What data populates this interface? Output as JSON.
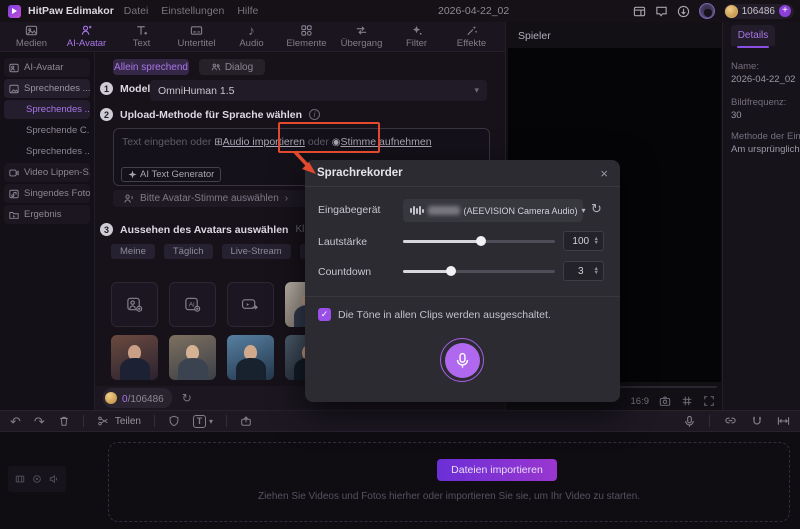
{
  "menubar": {
    "app_title": "HitPaw Edimakor",
    "menu_items": [
      "Datei",
      "Einstellungen",
      "Hilfe"
    ],
    "project_name": "2026-04-22_02",
    "credits": "106486"
  },
  "ribbon": {
    "tabs": [
      "Medien",
      "AI-Avatar",
      "Text",
      "Untertitel",
      "Audio",
      "Elemente",
      "Übergang",
      "Filter",
      "Effekte"
    ],
    "active_tab": "AI-Avatar"
  },
  "sidebar": {
    "items": [
      "AI-Avatar",
      "Sprechendes ...",
      "Sprechendes ...",
      "Sprechende C...",
      "Sprechendes ...",
      "Video Lippen-S...",
      "Singendes Foto",
      "Ergebnis"
    ]
  },
  "main": {
    "tab_solo": "Allein sprechend",
    "tab_dialog": "Dialog",
    "step1_num": "1",
    "step1_label": "Modell",
    "model_value": "OmniHuman 1.5",
    "step2_num": "2",
    "step2_label": "Upload-Methode für Sprache wählen",
    "text_prefix": "Text eingeben oder",
    "audio_link": "Audio importieren",
    "or_word": "oder",
    "record_link": "Stimme aufnehmen",
    "ai_generator": "AI Text Generator",
    "voice_select": "Bitte Avatar-Stimme auswählen",
    "step3_num": "3",
    "step3_label": "Aussehen des Avatars auswählen",
    "step3_hint": "Klicken Sie au",
    "categories": [
      "Meine",
      "Täglich",
      "Live-Stream",
      "Festival"
    ],
    "credits_used": "0",
    "credits_total": "/106486"
  },
  "player": {
    "title": "Spieler",
    "ratio": "16:9"
  },
  "details": {
    "tab": "Details",
    "fields": [
      {
        "label": "Name:",
        "value": "2026-04-22_02"
      },
      {
        "label": "Bildfrequenz:",
        "value": "30"
      },
      {
        "label": "Methode der Einfü",
        "value": "Am ursprünglichen"
      }
    ]
  },
  "dialog": {
    "title": "Sprachrekorder",
    "device_label": "Eingabegerät",
    "device_value": "(AEEVISION Camera Audio)",
    "volume_label": "Lautstärke",
    "volume_value": "100",
    "countdown_label": "Countdown",
    "countdown_value": "3",
    "mute_note": "Die Töne in allen Clips werden ausgeschaltet."
  },
  "toolbar": {
    "split_label": "Teilen"
  },
  "timeline": {
    "import_button": "Dateien importieren",
    "drop_hint": "Ziehen Sie Videos und Fotos hierher oder importieren Sie sie, um Ihr Video zu starten."
  },
  "icons": {
    "undo": "↶",
    "redo": "↷",
    "refresh": "↻",
    "chevron_down": "▾",
    "caret_up": "▲",
    "close": "×",
    "check": "✓",
    "note": "♪",
    "plus": "+",
    "info": "i",
    "radio": "◉",
    "import_square": "⊞",
    "chevron_right": "›"
  },
  "colors": {
    "accent": "#a976e8",
    "annotation": "#e14a2e"
  }
}
